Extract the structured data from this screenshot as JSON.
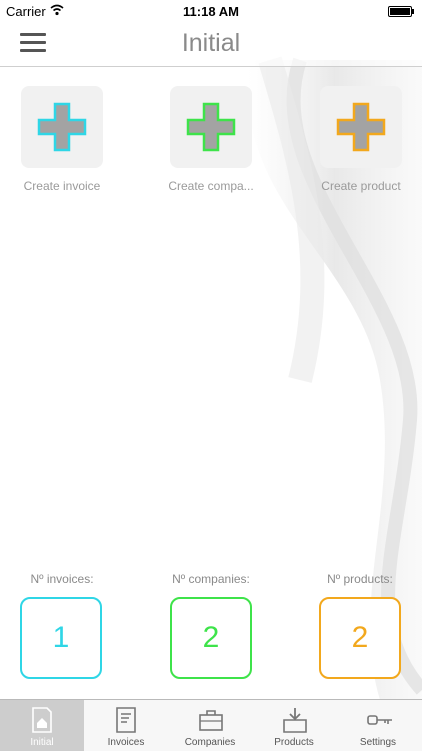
{
  "status_bar": {
    "carrier": "Carrier",
    "time": "11:18 AM"
  },
  "nav": {
    "title": "Initial",
    "menu_icon": "hamburger-menu-icon"
  },
  "actions": [
    {
      "label": "Create invoice",
      "icon": "plus-icon",
      "color": "#2fd6e6"
    },
    {
      "label": "Create compa...",
      "icon": "plus-icon",
      "color": "#3ee34a"
    },
    {
      "label": "Create product",
      "icon": "plus-icon",
      "color": "#f2a81d"
    }
  ],
  "counts": [
    {
      "label": "Nº invoices:",
      "value": "1",
      "color": "#2fd6e6"
    },
    {
      "label": "Nº companies:",
      "value": "2",
      "color": "#3ee34a"
    },
    {
      "label": "Nº products:",
      "value": "2",
      "color": "#f2a81d"
    }
  ],
  "tabs": [
    {
      "label": "Initial",
      "icon": "home-document-icon",
      "selected": true
    },
    {
      "label": "Invoices",
      "icon": "invoice-icon",
      "selected": false
    },
    {
      "label": "Companies",
      "icon": "briefcase-icon",
      "selected": false
    },
    {
      "label": "Products",
      "icon": "box-download-icon",
      "selected": false
    },
    {
      "label": "Settings",
      "icon": "key-icon",
      "selected": false
    }
  ]
}
